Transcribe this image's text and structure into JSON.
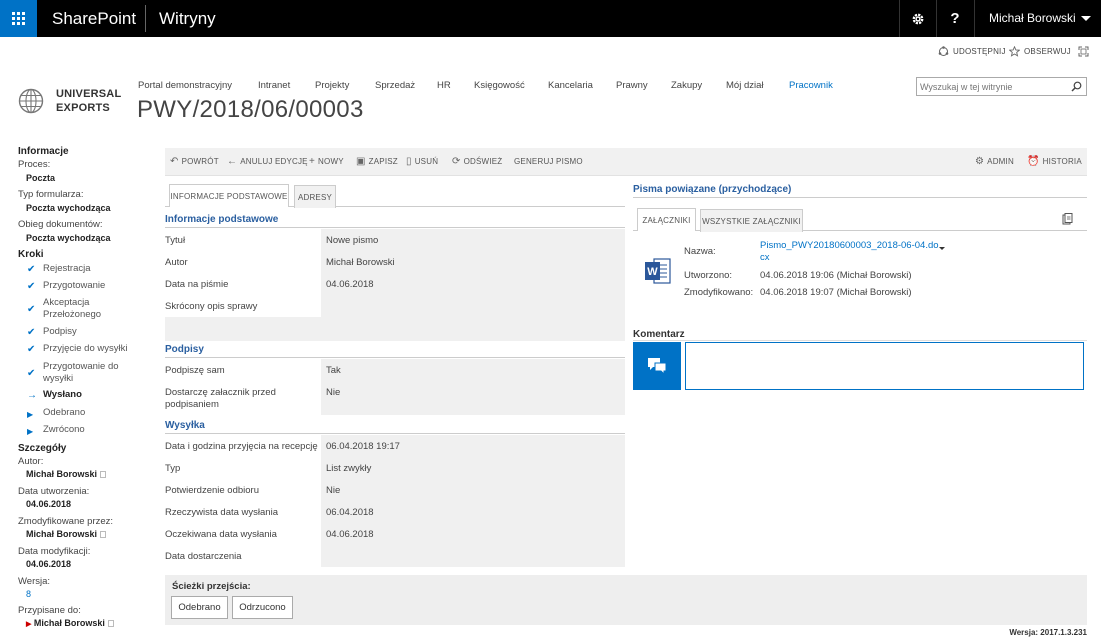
{
  "suite": {
    "brand": "SharePoint",
    "sites": "Witryny",
    "settings_icon": "gear-icon",
    "help_label": "?",
    "user": "Michał Borowski"
  },
  "share": {
    "share_label": "UDOSTĘPNIJ",
    "follow_label": "OBSERWUJ"
  },
  "logo": {
    "line1": "UNIVERSAL",
    "line2": "EXPORTS"
  },
  "nav": [
    "Portal demonstracyjny",
    "Intranet",
    "Projekty",
    "Sprzedaż",
    "HR",
    "Księgowość",
    "Kancelaria",
    "Prawny",
    "Zakupy",
    "Mój dział",
    "Pracownik"
  ],
  "search": {
    "placeholder": "Wyszukaj w tej witrynie"
  },
  "page_title": "PWY/2018/06/00003",
  "left": {
    "info_header": "Informacje",
    "process_label": "Proces:",
    "process_value": "Poczta",
    "form_type_label": "Typ formularza:",
    "form_type_value": "Poczta wychodząca",
    "doc_flow_label": "Obieg dokumentów:",
    "doc_flow_value": "Poczta wychodząca",
    "steps_header": "Kroki",
    "steps": [
      "Rejestracja",
      "Przygotowanie",
      "Akceptacja Przełożonego",
      "Podpisy",
      "Przyjęcie do wysyłki",
      "Przygotowanie do wysyłki",
      "Wysłano",
      "Odebrano",
      "Zwrócono"
    ],
    "details_header": "Szczegóły",
    "author_label": "Autor:",
    "author_value": "Michał Borowski",
    "created_label": "Data utworzenia:",
    "created_value": "04.06.2018",
    "modified_by_label": "Zmodyfikowane przez:",
    "modified_by_value": "Michał Borowski",
    "modified_label": "Data modyfikacji:",
    "modified_value": "04.06.2018",
    "version_label": "Wersja:",
    "version_value": "8",
    "assigned_label": "Przypisane do:",
    "assigned_value": "Michał Borowski"
  },
  "toolbar": {
    "back": "POWRÓT",
    "cancel": "ANULUJ EDYCJĘ",
    "new": "NOWY",
    "save": "ZAPISZ",
    "delete": "USUŃ",
    "refresh": "ODŚWIEŻ",
    "generate": "GENERUJ PISMO",
    "admin": "ADMIN",
    "history": "HISTORIA"
  },
  "tabs": {
    "basic": "INFORMACJE PODSTAWOWE",
    "addresses": "ADRESY"
  },
  "form": {
    "sec_basic": "Informacje podstawowe",
    "title_label": "Tytuł",
    "title_value": "Nowe pismo",
    "author_label": "Autor",
    "author_value": "Michał Borowski",
    "date_label": "Data na piśmie",
    "date_value": "04.06.2018",
    "summary_label": "Skrócony opis sprawy",
    "sec_signatures": "Podpisy",
    "sign_label": "Podpiszę sam",
    "sign_value": "Tak",
    "attach_label": "Dostarczę załacznik przed podpisaniem",
    "attach_value": "Nie",
    "sec_shipping": "Wysyłka",
    "reception_label": "Data i godzina przyjęcia na recepcję",
    "reception_value": "06.04.2018 19:17",
    "type_label": "Typ",
    "type_value": "List zwykły",
    "confirm_label": "Potwierdzenie odbioru",
    "confirm_value": "Nie",
    "actual_label": "Rzeczywista data wysłania",
    "actual_value": "06.04.2018",
    "expected_label": "Oczekiwana data wysłania",
    "expected_value": "04.06.2018",
    "delivery_label": "Data dostarczenia"
  },
  "related": {
    "title": "Pisma powiązane (przychodzące)",
    "tab_attachments": "ZAŁĄCZNIKI",
    "tab_all": "WSZYSTKIE ZAŁĄCZNIKI",
    "name_label": "Nazwa:",
    "name_value_line1": "Pismo_PWY20180600003_2018-06-04.do",
    "name_value_line2": "cx",
    "created_label": "Utworzono:",
    "created_value": "04.06.2018 19:06 (Michał Borowski)",
    "modified_label": "Zmodyfikowano:",
    "modified_value": "04.06.2018 19:07 (Michał Borowski)"
  },
  "comment": {
    "label": "Komentarz"
  },
  "transitions": {
    "label": "Ścieżki przejścia:",
    "received": "Odebrano",
    "rejected": "Odrzucono"
  },
  "footer": {
    "version": "Wersja: 2017.1.3.231"
  },
  "colors": {
    "accent": "#0072c6",
    "suitebar": "#000000",
    "section_title": "#2a5fa0"
  }
}
